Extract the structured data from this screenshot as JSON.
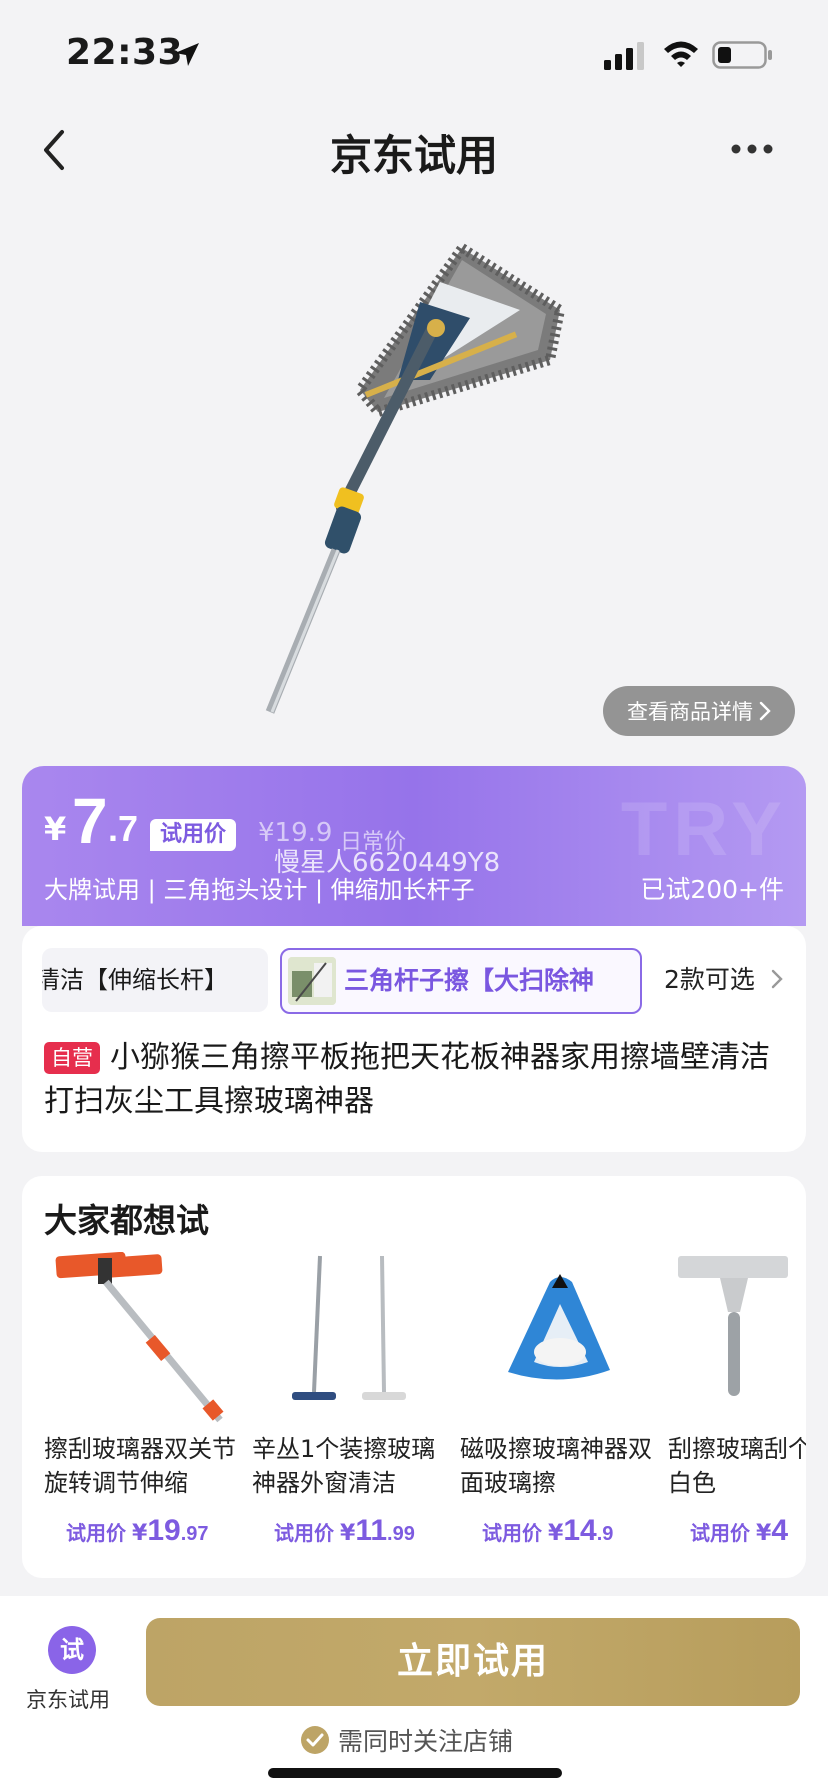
{
  "status_bar": {
    "time": "22:33"
  },
  "nav": {
    "title": "京东试用"
  },
  "hero": {
    "detail_button": "查看商品详情"
  },
  "price": {
    "currency": "¥",
    "int": "7",
    "dec": ".7",
    "trial_tag": "试用价",
    "original": "¥19.9",
    "original_label": "日常价",
    "watermark_user": "慢星人6620449Y8",
    "watermark_bg": "TRY",
    "features": "大牌试用  |  三角拖头设计  |  伸缩加长杆子",
    "tried": "已试200+件"
  },
  "product": {
    "variant_a": "清洁【伸缩长杆】",
    "variant_b": "三角杆子擦【大扫除神",
    "variant_count": "2款可选",
    "badge": "自营",
    "title": "小猕猴三角擦平板拖把天花板神器家用擦墙壁清洁打扫灰尘工具擦玻璃神器"
  },
  "recommend": {
    "title": "大家都想试",
    "items": [
      {
        "name": "擦刮玻璃器双关节旋转调节伸缩",
        "label": "试用价",
        "yen": "¥",
        "int": "19",
        "dec": ".97"
      },
      {
        "name": "辛丛1个装擦玻璃神器外窗清洁",
        "label": "试用价",
        "yen": "¥",
        "int": "11",
        "dec": ".99"
      },
      {
        "name": "磁吸擦玻璃神器双面玻璃擦",
        "label": "试用价",
        "yen": "¥",
        "int": "14",
        "dec": ".9"
      },
      {
        "name": "刮擦玻璃刮个装灰白色",
        "label": "试用价",
        "yen": "¥",
        "int": "4",
        "dec": ""
      }
    ]
  },
  "bottom": {
    "icon_char": "试",
    "jd_try_label": "京东试用",
    "cta": "立即试用",
    "follow_note": "需同时关注店铺"
  },
  "colors": {
    "accent_purple": "#8a64e8",
    "cta_gold": "#bda466",
    "badge_red": "#e62e4d"
  }
}
